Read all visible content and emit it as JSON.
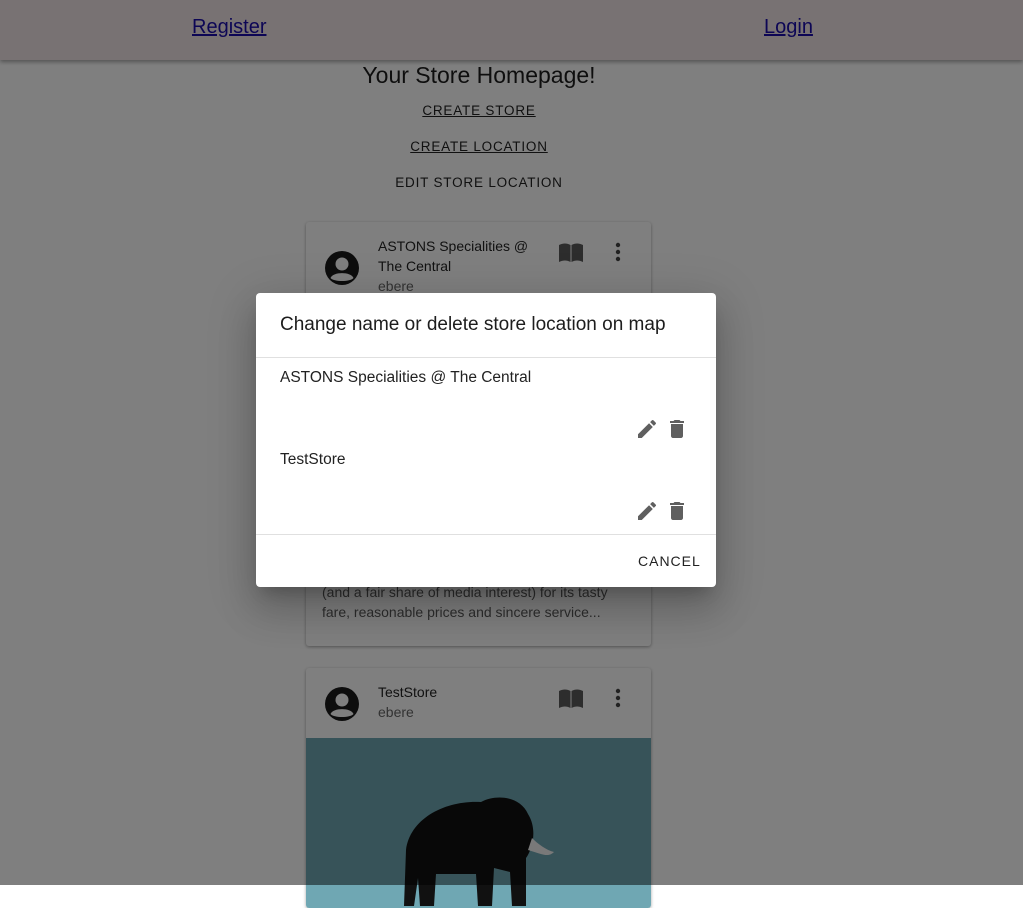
{
  "navbar": {
    "register_label": "Register",
    "login_label": "Login"
  },
  "page": {
    "title": "Your Store Homepage!",
    "create_store_label": "CREATE STORE",
    "create_location_label": "CREATE LOCATION",
    "edit_store_location_label": "EDIT STORE LOCATION"
  },
  "cards": [
    {
      "title": "ASTONS Specialities @ The Central",
      "owner": "ebere",
      "description": "(and a fair share of media interest) for its tasty fare, reasonable prices and sincere service..."
    },
    {
      "title": "TestStore",
      "owner": "ebere"
    }
  ],
  "dialog": {
    "title": "Change name or delete store location on map",
    "locations": [
      {
        "name": "ASTONS Specialities @ The Central"
      },
      {
        "name": "TestStore"
      }
    ],
    "cancel_label": "CANCEL"
  },
  "icons": {
    "avatar": "account-circle-icon",
    "book": "book-open-icon",
    "more": "more-vert-icon",
    "edit": "pencil-icon",
    "delete": "trash-icon"
  },
  "colors": {
    "navbar_bg": "#f0e4e6",
    "link": "#1a0dab",
    "card_media_bg": "#6fa7b3"
  }
}
